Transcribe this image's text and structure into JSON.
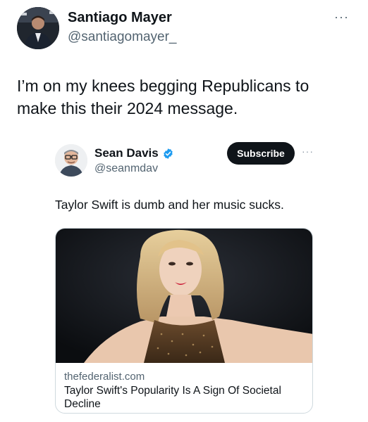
{
  "tweet": {
    "author": {
      "name": "Santiago Mayer",
      "handle": "@santiagomayer_"
    },
    "more_label": "···",
    "text": "I’m on my knees begging Republicans to make this their 2024 message."
  },
  "quoted_tweet": {
    "author": {
      "name": "Sean Davis",
      "handle": "@seanmdav"
    },
    "subscribe_label": "Subscribe",
    "more_label": "···",
    "text": "Taylor Swift is dumb and her music sucks.",
    "link_card": {
      "domain": "thefederalist.com",
      "title": "Taylor Swift's Popularity Is A Sign Of Societal Decline"
    }
  },
  "colors": {
    "text_primary": "#0f1419",
    "text_secondary": "#536471",
    "verified_blue": "#1d9bf0",
    "button_dark": "#0f1419",
    "border": "#cfd9de"
  },
  "icons": {
    "verified": "verified-badge-icon",
    "more": "more-horizontal-icon"
  }
}
